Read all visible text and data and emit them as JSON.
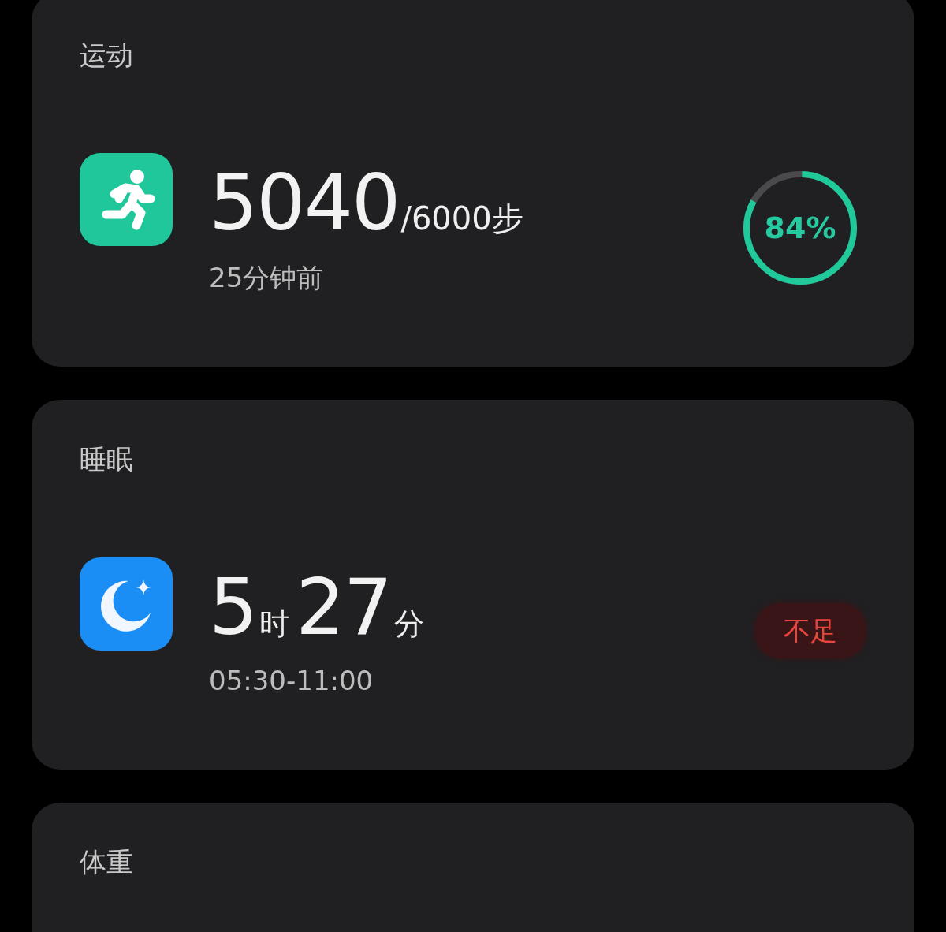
{
  "cards": [
    {
      "kind": "steps",
      "title": "运动",
      "value": "5040",
      "goal": "/6000步",
      "subtitle": "25分钟前",
      "progress": {
        "level": 0.84,
        "label": "84%"
      }
    },
    {
      "kind": "sleep",
      "title": "睡眠",
      "parts": [
        {
          "text": "5",
          "kind": "number"
        },
        {
          "text": "时",
          "kind": "unit"
        },
        {
          "text": "27",
          "kind": "number"
        },
        {
          "text": "分",
          "kind": "unit"
        }
      ],
      "subtitle": "05:30-11:00",
      "badge": "不足"
    },
    {
      "kind": "weight",
      "title": "体重"
    }
  ]
}
